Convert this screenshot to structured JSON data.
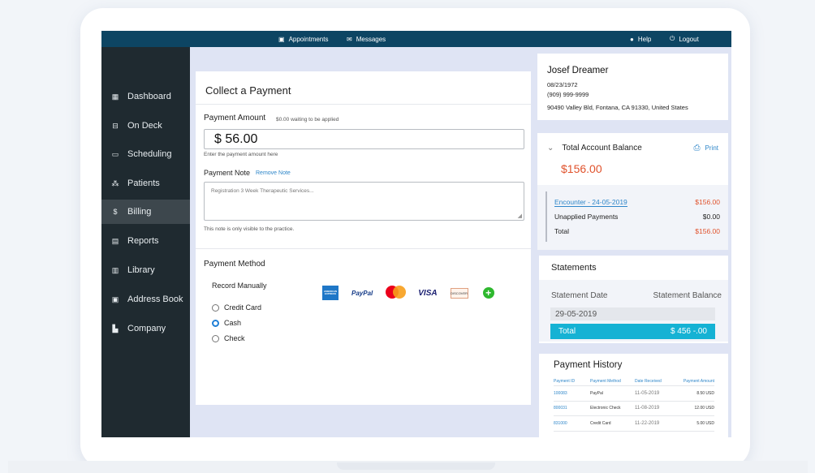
{
  "topbar": {
    "appointments": "Appointments",
    "messages": "Messages",
    "help": "Help",
    "logout": "Logout"
  },
  "sidebar": {
    "items": [
      {
        "label": "Dashboard",
        "icon": "dashboard-icon"
      },
      {
        "label": "On Deck",
        "icon": "on-deck-icon"
      },
      {
        "label": "Scheduling",
        "icon": "calendar-icon"
      },
      {
        "label": "Patients",
        "icon": "patients-icon"
      },
      {
        "label": "Billing",
        "icon": "dollar-icon",
        "active": true
      },
      {
        "label": "Reports",
        "icon": "reports-icon"
      },
      {
        "label": "Library",
        "icon": "library-icon"
      },
      {
        "label": "Address Book",
        "icon": "address-book-icon"
      },
      {
        "label": "Company",
        "icon": "company-icon"
      }
    ]
  },
  "payment": {
    "title": "Collect a Payment",
    "amount_label": "Payment Amount",
    "amount_hint": "$0.00 waiting to be applied",
    "amount_value": "$ 56.00",
    "amount_help": "Enter the payment amount here",
    "note_label": "Payment Note",
    "remove_note": "Remove Note",
    "note_placeholder": "Registration 3 Week Therapeutic Services...",
    "note_help": "This note is only visible to the practice.",
    "method_title": "Payment Method",
    "record_manually": "Record Manually",
    "methods": [
      {
        "label": "Credit Card",
        "selected": false
      },
      {
        "label": "Cash",
        "selected": true
      },
      {
        "label": "Check",
        "selected": false
      }
    ],
    "card_brands": {
      "amex": "AMERICAN EXPRESS",
      "paypal": "PayPal",
      "visa": "VISA",
      "discover": "DISCOVER"
    }
  },
  "patient": {
    "name": "Josef Dreamer",
    "dob": "08/23/1972",
    "phone": "(909) 999-9999",
    "address": "90490 Valley Bld, Fontana, CA 91330, United States"
  },
  "balance": {
    "title": "Total Account Balance",
    "amount": "$156.00",
    "print": "Print",
    "encounter_label": "Encounter - 24-05-2019",
    "encounter_amount": "$156.00",
    "unapplied_label": "Unapplied Payments",
    "unapplied_amount": "$0.00",
    "total_label": "Total",
    "total_amount": "$156.00"
  },
  "statements": {
    "title": "Statements",
    "col_date": "Statement Date",
    "col_balance": "Statement Balance",
    "row_date": "29-05-2019",
    "total_label": "Total",
    "total_value": "$ 456 -.00"
  },
  "history": {
    "title": "Payment History",
    "headers": [
      "Payment ID",
      "Payment Method",
      "Date Received",
      "Payment Amount"
    ],
    "rows": [
      [
        "100083",
        "PayPal",
        "11-05-2019",
        "8.50 USD"
      ],
      [
        "800031",
        "Electronic Check",
        "11-08-2019",
        "12.00 USD"
      ],
      [
        "831000",
        "Credit Card",
        "11-22-2019",
        "5.00 USD"
      ]
    ]
  },
  "colors": {
    "topbar": "#0d4563",
    "sidebar": "#1f2a30",
    "accent_blue": "#2e86c9",
    "accent_red": "#e0522c",
    "statement_total": "#15b2d4"
  }
}
